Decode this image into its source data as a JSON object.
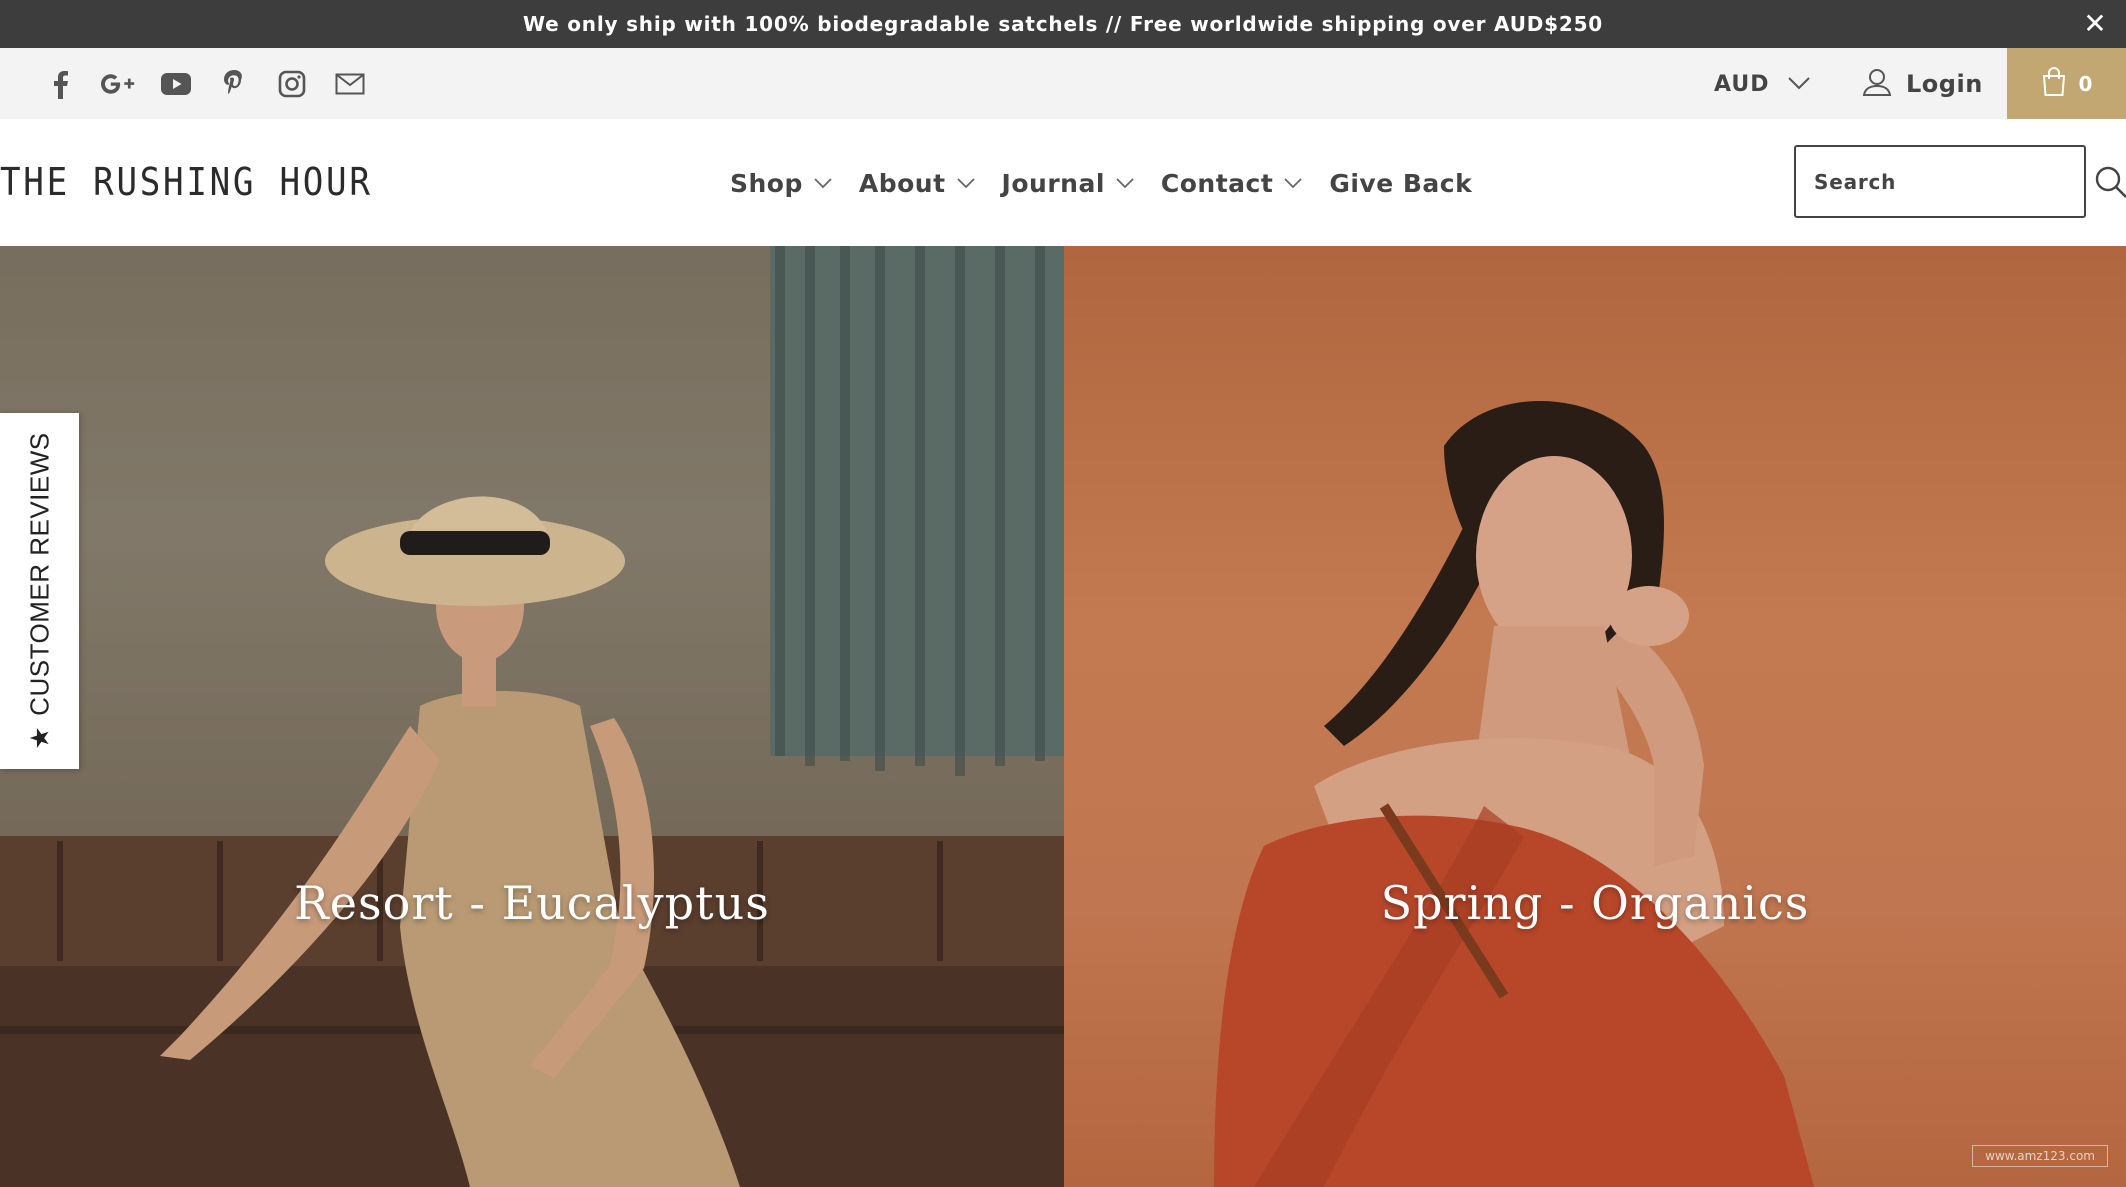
{
  "announcement": {
    "text": "We only ship with 100% biodegradable satchels // Free worldwide shipping over AUD$250",
    "close_icon": "close-icon"
  },
  "utility_bar": {
    "social_icons": [
      "facebook-icon",
      "google-plus-icon",
      "youtube-icon",
      "pinterest-icon",
      "instagram-icon",
      "email-icon"
    ],
    "currency": "AUD",
    "login_label": "Login",
    "cart_count": "0"
  },
  "header": {
    "logo_text": "THE RUSHING HOUR",
    "nav": [
      {
        "label": "Shop",
        "has_dropdown": true
      },
      {
        "label": "About",
        "has_dropdown": true
      },
      {
        "label": "Journal",
        "has_dropdown": true
      },
      {
        "label": "Contact",
        "has_dropdown": true
      },
      {
        "label": "Give Back",
        "has_dropdown": false
      }
    ],
    "search_placeholder": "Search"
  },
  "hero": {
    "panels": [
      {
        "title": "Resort - Eucalyptus"
      },
      {
        "title": "Spring - Organics"
      }
    ],
    "watermark": "www.amz123.com"
  },
  "reviews_tab": {
    "star": "★",
    "label": "CUSTOMER REVIEWS"
  },
  "colors": {
    "announcement_bg": "#3d3d3d",
    "utility_bg": "#f3f3f3",
    "cart_bg": "#c2a772",
    "text_dark": "#444444"
  }
}
